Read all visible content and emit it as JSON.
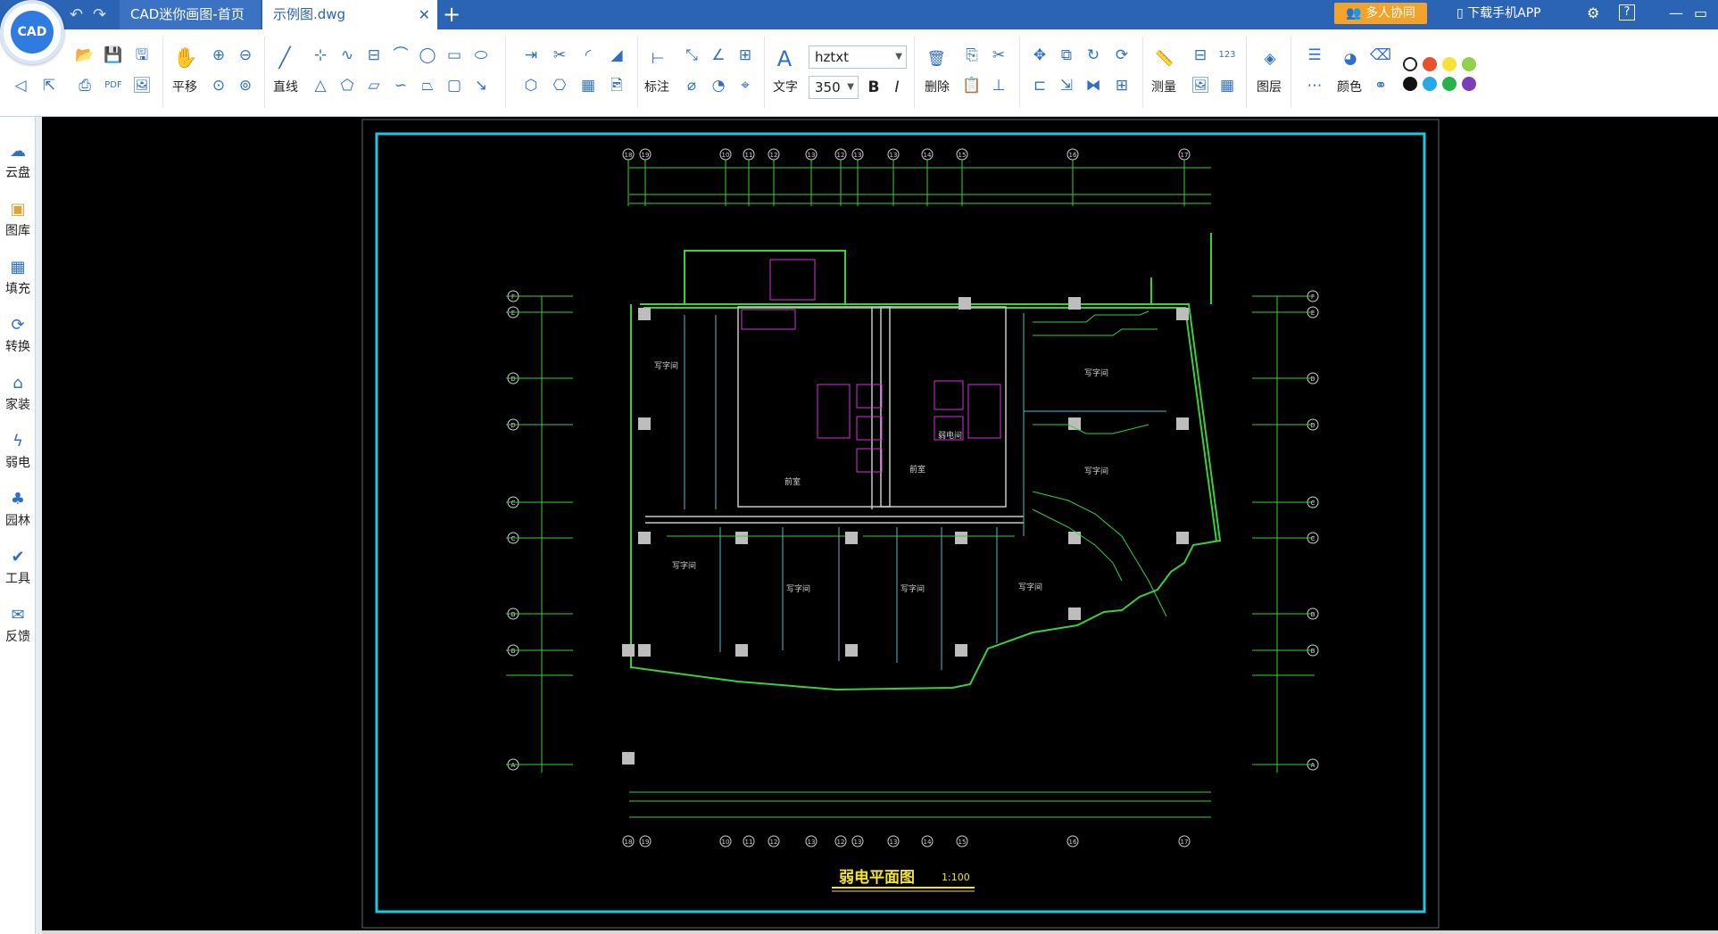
{
  "app": {
    "logo_text": "CAD"
  },
  "tabs": [
    {
      "label": "CAD迷你画图-首页"
    },
    {
      "label": "示例图.dwg",
      "close": "✕"
    }
  ],
  "header": {
    "collab_label": "多人协同",
    "download_label": "下载手机APP"
  },
  "toolbar": {
    "pan_label": "平移",
    "line_label": "直线",
    "dim_label": "标注",
    "text_label": "文字",
    "font_name": "hztxt",
    "font_size": "350",
    "bold_label": "B",
    "italic_label": "I",
    "delete_label": "删除",
    "measure_label": "测量",
    "layer_label": "图层",
    "color_label": "颜色"
  },
  "colors": {
    "swatches_row1": [
      "#000000",
      "#e8502a",
      "#f3e233",
      "#93d04b"
    ],
    "swatches_row2": [
      "#111111",
      "#27a9e6",
      "#27b24a",
      "#7a3fb8"
    ],
    "accent": "#2b63b5",
    "frame": "#1ec8e0",
    "wall": "#39d039",
    "magenta": "#d632d6"
  },
  "sidebar": {
    "items": [
      {
        "label": "云盘",
        "icon": "cloud-icon"
      },
      {
        "label": "图库",
        "icon": "gallery-icon"
      },
      {
        "label": "填充",
        "icon": "hatch-icon"
      },
      {
        "label": "转换",
        "icon": "convert-icon"
      },
      {
        "label": "家装",
        "icon": "home-icon"
      },
      {
        "label": "弱电",
        "icon": "lightning-icon"
      },
      {
        "label": "园林",
        "icon": "tree-icon"
      },
      {
        "label": "工具",
        "icon": "tool-icon"
      },
      {
        "label": "反馈",
        "icon": "mail-icon"
      }
    ]
  },
  "drawing": {
    "title": "弱电平面图",
    "scale": "1:100",
    "top_axes": [
      "18",
      "19",
      "10",
      "11",
      "12",
      "13",
      "12",
      "13",
      "13",
      "14",
      "15",
      "16",
      "17"
    ],
    "side_axes": [
      "F",
      "E",
      "D",
      "D",
      "C",
      "C",
      "B",
      "B",
      "A"
    ],
    "room_labels": [
      "写字间",
      "写字间",
      "写字间",
      "写字间",
      "写字间",
      "写字间",
      "写字间",
      "前室",
      "前室",
      "弱电间"
    ]
  }
}
